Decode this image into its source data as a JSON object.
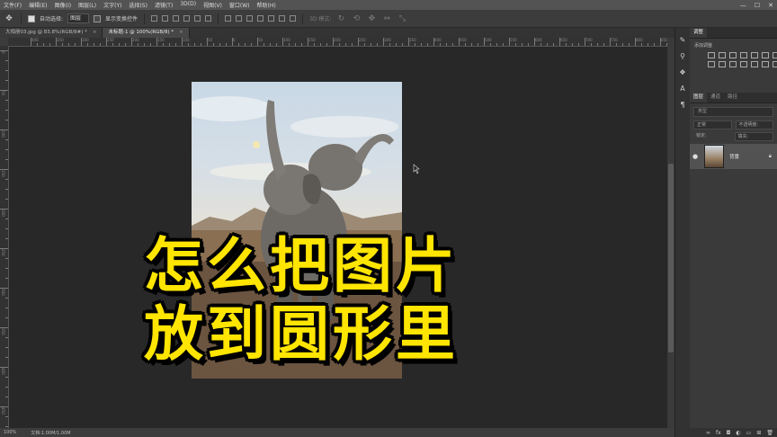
{
  "menu": {
    "items": [
      "文件(F)",
      "编辑(E)",
      "图像(I)",
      "图层(L)",
      "文字(Y)",
      "选择(S)",
      "滤镜(T)",
      "3D(D)",
      "视图(V)",
      "窗口(W)",
      "帮助(H)"
    ]
  },
  "window_controls": {
    "minimize": "—",
    "maximize": "☐",
    "close": "✕"
  },
  "options": {
    "auto_select_label": "自动选择:",
    "auto_select_value": "图层",
    "show_transform_label": "显示变换控件",
    "mode_3d_label": "3D 模式:"
  },
  "tabs": [
    {
      "label": "大相册03.jpg @ 83.8%(RGB/8#) *",
      "close": "×"
    },
    {
      "label": "未标题-1 @ 100%(RGB/8) *",
      "close": "×"
    }
  ],
  "ruler": {
    "top": [
      "400",
      "350",
      "300",
      "250",
      "200",
      "150",
      "100",
      "50",
      "0",
      "50",
      "100",
      "150",
      "200",
      "250",
      "300",
      "350",
      "400",
      "450",
      "500",
      "550",
      "600",
      "650",
      "700",
      "750",
      "800",
      "850"
    ],
    "left": [
      "0",
      "50",
      "100",
      "150",
      "200",
      "250",
      "300",
      "350",
      "400",
      "450"
    ]
  },
  "canvas": {
    "overlay_line1": "怎么把图片",
    "overlay_line2": "放到圆形里",
    "overlay_color": "#ffe500"
  },
  "status": {
    "zoom": "100%",
    "doc": "文档:1.00M/1.00M"
  },
  "panels": {
    "adjust_tabs": [
      "调整"
    ],
    "adjust_title": "添加调整",
    "layer_tabs": [
      "图层",
      "通道",
      "路径"
    ],
    "filter_placeholder": "类型",
    "blend_mode": "正常",
    "opacity_label": "不透明度:",
    "lock_label": "锁定:",
    "fill_label": "填充:",
    "layer_name": "背景"
  }
}
